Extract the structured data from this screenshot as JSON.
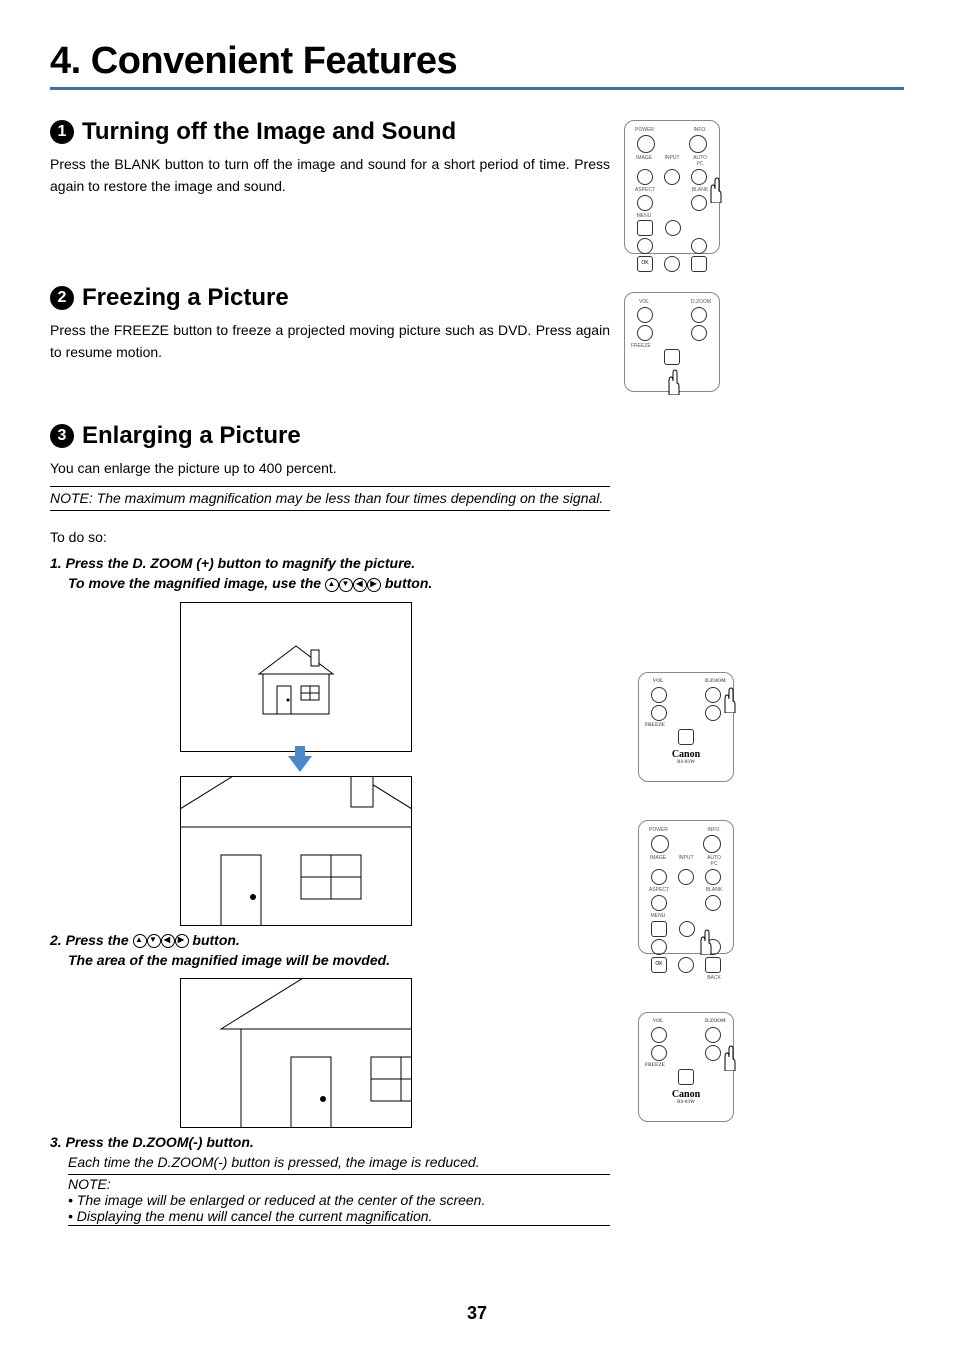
{
  "chapter_title": "4. Convenient Features",
  "sections": {
    "s1": {
      "num": "1",
      "heading": "Turning off the Image and Sound",
      "body": "Press the BLANK button to turn off the image and sound for a short period of time. Press again to restore the image and sound."
    },
    "s2": {
      "num": "2",
      "heading": "Freezing a Picture",
      "body": "Press the FREEZE button to freeze a projected moving picture such as DVD. Press again to resume motion."
    },
    "s3": {
      "num": "3",
      "heading": "Enlarging a Picture",
      "body": "You can enlarge the picture up to 400 percent.",
      "note": "NOTE: The maximum magnification may be less than four times depending on the signal.",
      "todo": "To do so:",
      "step1": "1.  Press the D. ZOOM (+) button to magnify the picture.",
      "step1_sub": "To move the magnified image, use the ",
      "step1_sub_tail": " button.",
      "step2": "2. Press the ",
      "step2_tail": " button.",
      "step2_sub": "The area of the magnified image will be movded.",
      "step3": "3. Press the D.ZOOM(-) button.",
      "step3_sub": "Each time the D.ZOOM(-) button is pressed, the image is reduced.",
      "note2_head": "NOTE:",
      "note2_l1": "• The image will be enlarged or reduced at the center of the screen.",
      "note2_l2": "• Displaying the menu will cancel the current magnification."
    }
  },
  "remote_labels": {
    "power": "POWER",
    "info": "INFO.",
    "image": "IMAGE",
    "input": "INPUT",
    "autopc": "AUTO PC",
    "aspect": "ASPECT",
    "blank": "BLANK",
    "menu": "MENU",
    "ok": "OK",
    "back": "BACK",
    "vol": "VOL",
    "dzoom": "D.ZOOM",
    "freeze": "FREEZE",
    "brand": "Canon",
    "model": "RS-03W"
  },
  "page_number": "37"
}
